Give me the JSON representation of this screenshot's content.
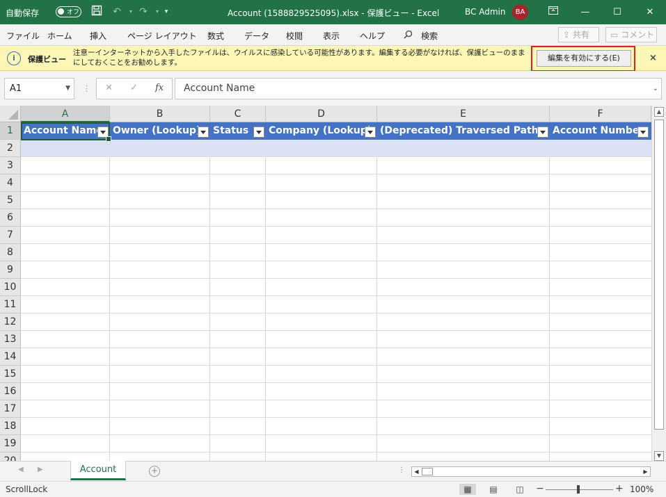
{
  "titlebar": {
    "autosave_label": "自動保存",
    "autosave_state": "オフ",
    "title": "Account (1588829525095).xlsx  -  保護ビュー  -  Excel",
    "user_name": "BC Admin",
    "user_initials": "BA",
    "brand_color": "#217346"
  },
  "ribbon": {
    "tabs": [
      "ファイル",
      "ホーム",
      "挿入",
      "ページ レイアウト",
      "数式",
      "データ",
      "校閲",
      "表示",
      "ヘルプ"
    ],
    "search_label": "検索",
    "share_label": "共有",
    "comment_label": "コメント"
  },
  "protected_view": {
    "title": "保護ビュー",
    "message": "注意ーインターネットから入手したファイルは、ウイルスに感染している可能性があります。編集する必要がなければ、保護ビューのままにしておくことをお勧めします。",
    "enable_button": "編集を有効にする(E)",
    "close_icon": "×"
  },
  "formula_bar": {
    "name_box": "A1",
    "fx": "fx",
    "formula": "Account Name"
  },
  "grid": {
    "columns": [
      "A",
      "B",
      "C",
      "D",
      "E",
      "F"
    ],
    "rows": [
      "1",
      "2",
      "3",
      "4",
      "5",
      "6",
      "7",
      "8",
      "9",
      "10",
      "11",
      "12",
      "13",
      "14",
      "15",
      "16",
      "17",
      "18",
      "19",
      "20"
    ],
    "headers": [
      "Account Name",
      "Owner (Lookup)",
      "Status",
      "Company (Lookup)",
      "(Deprecated) Traversed Path",
      "Account Number"
    ],
    "table_header_color": "#4472c4",
    "table_band_color": "#d9e1f2"
  },
  "sheets": {
    "tabs": [
      "Account"
    ],
    "active": "Account"
  },
  "status": {
    "mode": "ScrollLock",
    "zoom": "100%"
  }
}
